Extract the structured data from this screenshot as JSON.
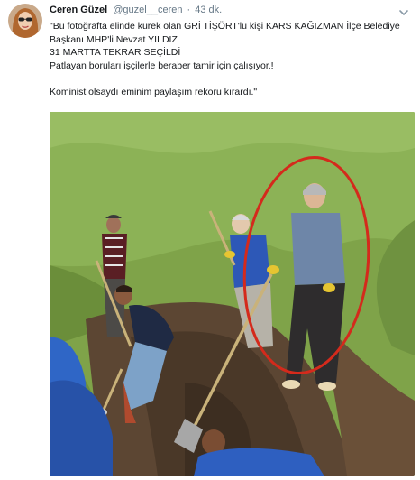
{
  "tweet": {
    "display_name": "Ceren Güzel",
    "handle": "@guzel__ceren",
    "separator": "·",
    "time": "43 dk.",
    "text_lines": [
      "\"Bu fotoğrafta elinde kürek olan GRİ TİŞÖRT'lü kişi KARS KAĞIZMAN İlçe Belediye",
      "Başkanı MHP'li Nevzat YILDIZ",
      "31 MARTTA TEKRAR SEÇİLDİ",
      "Patlayan boruları işçilerle beraber tamir için çalışıyor.!",
      "",
      "Kominist olsaydı eminim paylaşım rekoru kırardı.\""
    ]
  },
  "icons": {
    "avatar": "user-avatar",
    "caret": "chevron-down-icon"
  },
  "colors": {
    "text": "#14171a",
    "secondary": "#657786",
    "highlight_circle": "#d42a1c"
  }
}
